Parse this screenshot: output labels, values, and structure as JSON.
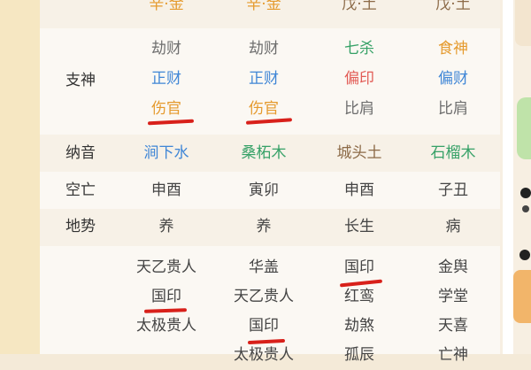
{
  "top_row": {
    "c1": "辛·金",
    "c2": "辛·金",
    "c3": "戊·土",
    "c4": "戊·土"
  },
  "zhishen": {
    "label": "支神",
    "col1": [
      "劫财",
      "正财",
      "伤官"
    ],
    "col2": [
      "劫财",
      "正财",
      "伤官"
    ],
    "col3": [
      "七杀",
      "偏印",
      "比肩"
    ],
    "col4": [
      "食神",
      "偏财",
      "比肩"
    ]
  },
  "nayin": {
    "label": "纳音",
    "values": [
      "涧下水",
      "桑柘木",
      "城头土",
      "石榴木"
    ]
  },
  "kongwang": {
    "label": "空亡",
    "values": [
      "申酉",
      "寅卯",
      "申酉",
      "子丑"
    ]
  },
  "dishi": {
    "label": "地势",
    "values": [
      "养",
      "养",
      "长生",
      "病"
    ]
  },
  "shensha": {
    "col1": [
      "天乙贵人",
      "国印",
      "太极贵人"
    ],
    "col2": [
      "华盖",
      "天乙贵人",
      "国印",
      "太极贵人"
    ],
    "col3": [
      "国印",
      "红鸾",
      "劫煞",
      "孤辰"
    ],
    "col4": [
      "金舆",
      "学堂",
      "天喜",
      "亡神"
    ]
  },
  "colors": {
    "underline": "#d8201a",
    "wood": "#36a167",
    "water": "#3f86d6",
    "fire": "#e25b55",
    "earth": "#8c6a47",
    "metal": "#e59a2e"
  }
}
